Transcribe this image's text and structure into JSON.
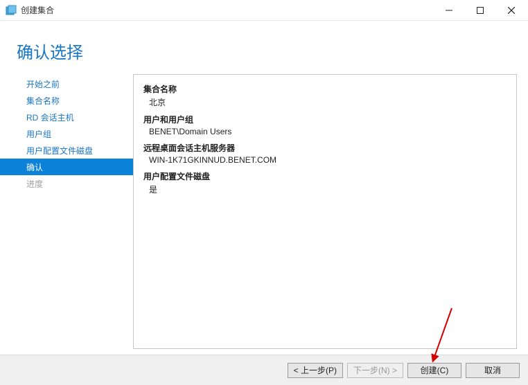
{
  "window": {
    "title": "创建集合"
  },
  "page": {
    "title": "确认选择"
  },
  "sidebar": {
    "items": [
      {
        "label": "开始之前",
        "state": "link"
      },
      {
        "label": "集合名称",
        "state": "link"
      },
      {
        "label": "RD 会话主机",
        "state": "link"
      },
      {
        "label": "用户组",
        "state": "link"
      },
      {
        "label": "用户配置文件磁盘",
        "state": "link"
      },
      {
        "label": "确认",
        "state": "selected"
      },
      {
        "label": "进度",
        "state": "disabled"
      }
    ]
  },
  "details": {
    "collection_name_label": "集合名称",
    "collection_name_value": "北京",
    "user_group_label": "用户和用户组",
    "user_group_value": "BENET\\Domain Users",
    "rdsh_label": "远程桌面会话主机服务器",
    "rdsh_value": "WIN-1K71GKINNUD.BENET.COM",
    "upd_label": "用户配置文件磁盘",
    "upd_value": "是"
  },
  "footer": {
    "prev": "< 上一步(P)",
    "next": "下一步(N) >",
    "create": "创建(C)",
    "cancel": "取消"
  }
}
